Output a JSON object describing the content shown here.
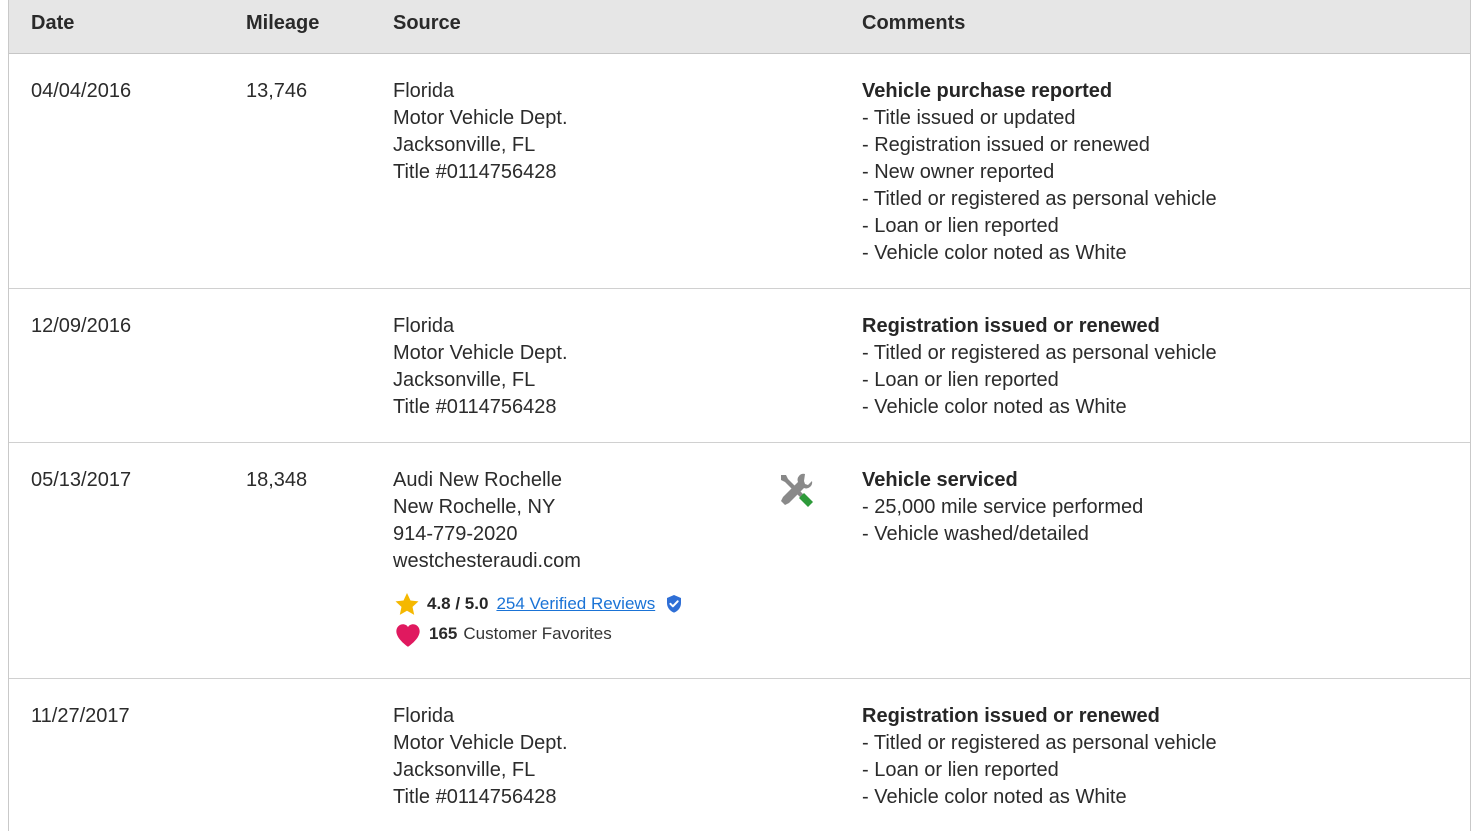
{
  "table": {
    "headers": {
      "date": "Date",
      "mileage": "Mileage",
      "source": "Source",
      "comments": "Comments"
    },
    "rows": [
      {
        "date": "04/04/2016",
        "mileage": "13,746",
        "source": [
          "Florida",
          "Motor Vehicle Dept.",
          "Jacksonville, FL",
          "Title #0114756428"
        ],
        "comment_title": "Vehicle purchase reported",
        "comment_items": [
          "- Title issued or updated",
          "- Registration issued or renewed",
          "- New owner reported",
          "- Titled or registered as personal vehicle",
          "- Loan or lien reported",
          "- Vehicle color noted as White"
        ]
      },
      {
        "date": "12/09/2016",
        "mileage": "",
        "source": [
          "Florida",
          "Motor Vehicle Dept.",
          "Jacksonville, FL",
          "Title #0114756428"
        ],
        "comment_title": "Registration issued or renewed",
        "comment_items": [
          "- Titled or registered as personal vehicle",
          "- Loan or lien reported",
          "- Vehicle color noted as White"
        ]
      },
      {
        "date": "05/13/2017",
        "mileage": "18,348",
        "source": [
          "Audi New Rochelle",
          "New Rochelle, NY",
          "914-779-2020",
          "westchesteraudi.com"
        ],
        "rating": "4.8 / 5.0",
        "reviews_link": "254 Verified Reviews",
        "favorites_count": "165",
        "favorites_label": "Customer Favorites",
        "icon": "service-tools-icon",
        "comment_title": "Vehicle serviced",
        "comment_items": [
          "- 25,000 mile service performed",
          "- Vehicle washed/detailed"
        ]
      },
      {
        "date": "11/27/2017",
        "mileage": "",
        "source": [
          "Florida",
          "Motor Vehicle Dept.",
          "Jacksonville, FL",
          "Title #0114756428"
        ],
        "comment_title": "Registration issued or renewed",
        "comment_items": [
          "- Titled or registered as personal vehicle",
          "- Loan or lien reported",
          "- Vehicle color noted as White"
        ]
      }
    ]
  },
  "colors": {
    "header_bg": "#e6e6e6",
    "link": "#1a73d6",
    "star": "#f5b800",
    "heart": "#e0195f",
    "verified": "#2f6fd6",
    "tools_gray": "#888888",
    "tools_green": "#2e9a3a"
  },
  "icons": {
    "star": "star-icon",
    "verified": "verified-shield-icon",
    "heart": "heart-icon",
    "service": "service-tools-icon"
  }
}
